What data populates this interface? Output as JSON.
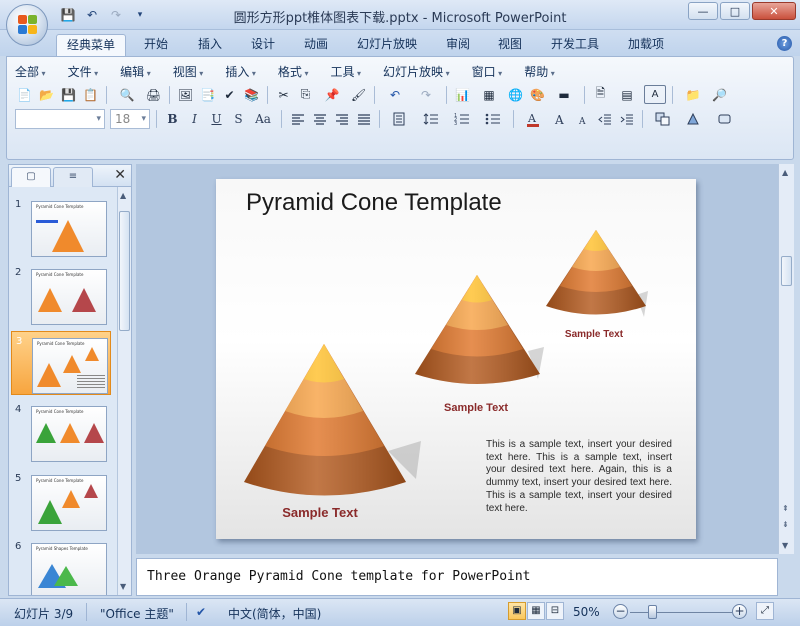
{
  "window": {
    "title": "圆形方形ppt椎体图表下载.pptx - Microsoft PowerPoint",
    "controls": [
      "—",
      "□",
      "✕"
    ]
  },
  "qat": {
    "save": "💾",
    "undo": "↶",
    "redo": "↷",
    "customize": "▾"
  },
  "tabs": [
    {
      "label": "经典菜单",
      "active": true
    },
    {
      "label": "开始"
    },
    {
      "label": "插入"
    },
    {
      "label": "设计"
    },
    {
      "label": "动画"
    },
    {
      "label": "幻灯片放映"
    },
    {
      "label": "审阅"
    },
    {
      "label": "视图"
    },
    {
      "label": "开发工具"
    },
    {
      "label": "加载项"
    }
  ],
  "help_label": "?",
  "menus": [
    "全部",
    "文件",
    "编辑",
    "视图",
    "插入",
    "格式",
    "工具",
    "幻灯片放映",
    "窗口",
    "帮助"
  ],
  "font": {
    "name_placeholder": "",
    "size": "18"
  },
  "format_buttons": [
    "B",
    "I",
    "U",
    "S",
    "Aa"
  ],
  "toolbar_a": [
    "📄",
    "📂",
    "💾",
    "📋",
    "🔍",
    "🖨",
    "🖼",
    "📑",
    "✔",
    "📚",
    "✂",
    "⎘",
    "📌",
    "🖌",
    "↶",
    "↷",
    "📊",
    "▦",
    "🌐",
    "🎨",
    "▬",
    "🗎",
    "▤",
    "A",
    "📁",
    "🔎"
  ],
  "thumbs": {
    "tab_slides": "▢",
    "tab_outline": "≡",
    "close": "✕",
    "items": [
      {
        "num": "1",
        "title": "Pyramid Cone Template"
      },
      {
        "num": "2",
        "title": "Pyramid Cone Template"
      },
      {
        "num": "3",
        "title": "Pyramid Cone Template",
        "selected": true
      },
      {
        "num": "4",
        "title": "Pyramid Cone Template"
      },
      {
        "num": "5",
        "title": "Pyramid Cone Template"
      },
      {
        "num": "6",
        "title": "Pyramid Shapes Template"
      }
    ]
  },
  "slide": {
    "title": "Pyramid Cone Template",
    "cones": [
      {
        "label": "Sample Text",
        "size": "large"
      },
      {
        "label": "Sample Text",
        "size": "medium"
      },
      {
        "label": "Sample Text",
        "size": "small"
      }
    ],
    "body": "This is a sample text, insert your desired text here. This is a sample text, insert your desired text here. Again, this is a dummy text, insert your desired text here. This is a sample text, insert your desired text here.",
    "colors": {
      "cone_top": "#ffb21a",
      "cone_mid": "#f08a2c",
      "cone_base": "#b45a1e",
      "label": "#8a2a2a"
    }
  },
  "notes": "Three Orange Pyramid Cone template for PowerPoint",
  "status": {
    "slide_info": "幻灯片 3/9",
    "theme": "\"Office 主题\"",
    "language": "中文(简体，中国)",
    "zoom": "50%",
    "zoom_level_percent": 50,
    "view_buttons": [
      "▣",
      "▦",
      "⊟"
    ]
  }
}
